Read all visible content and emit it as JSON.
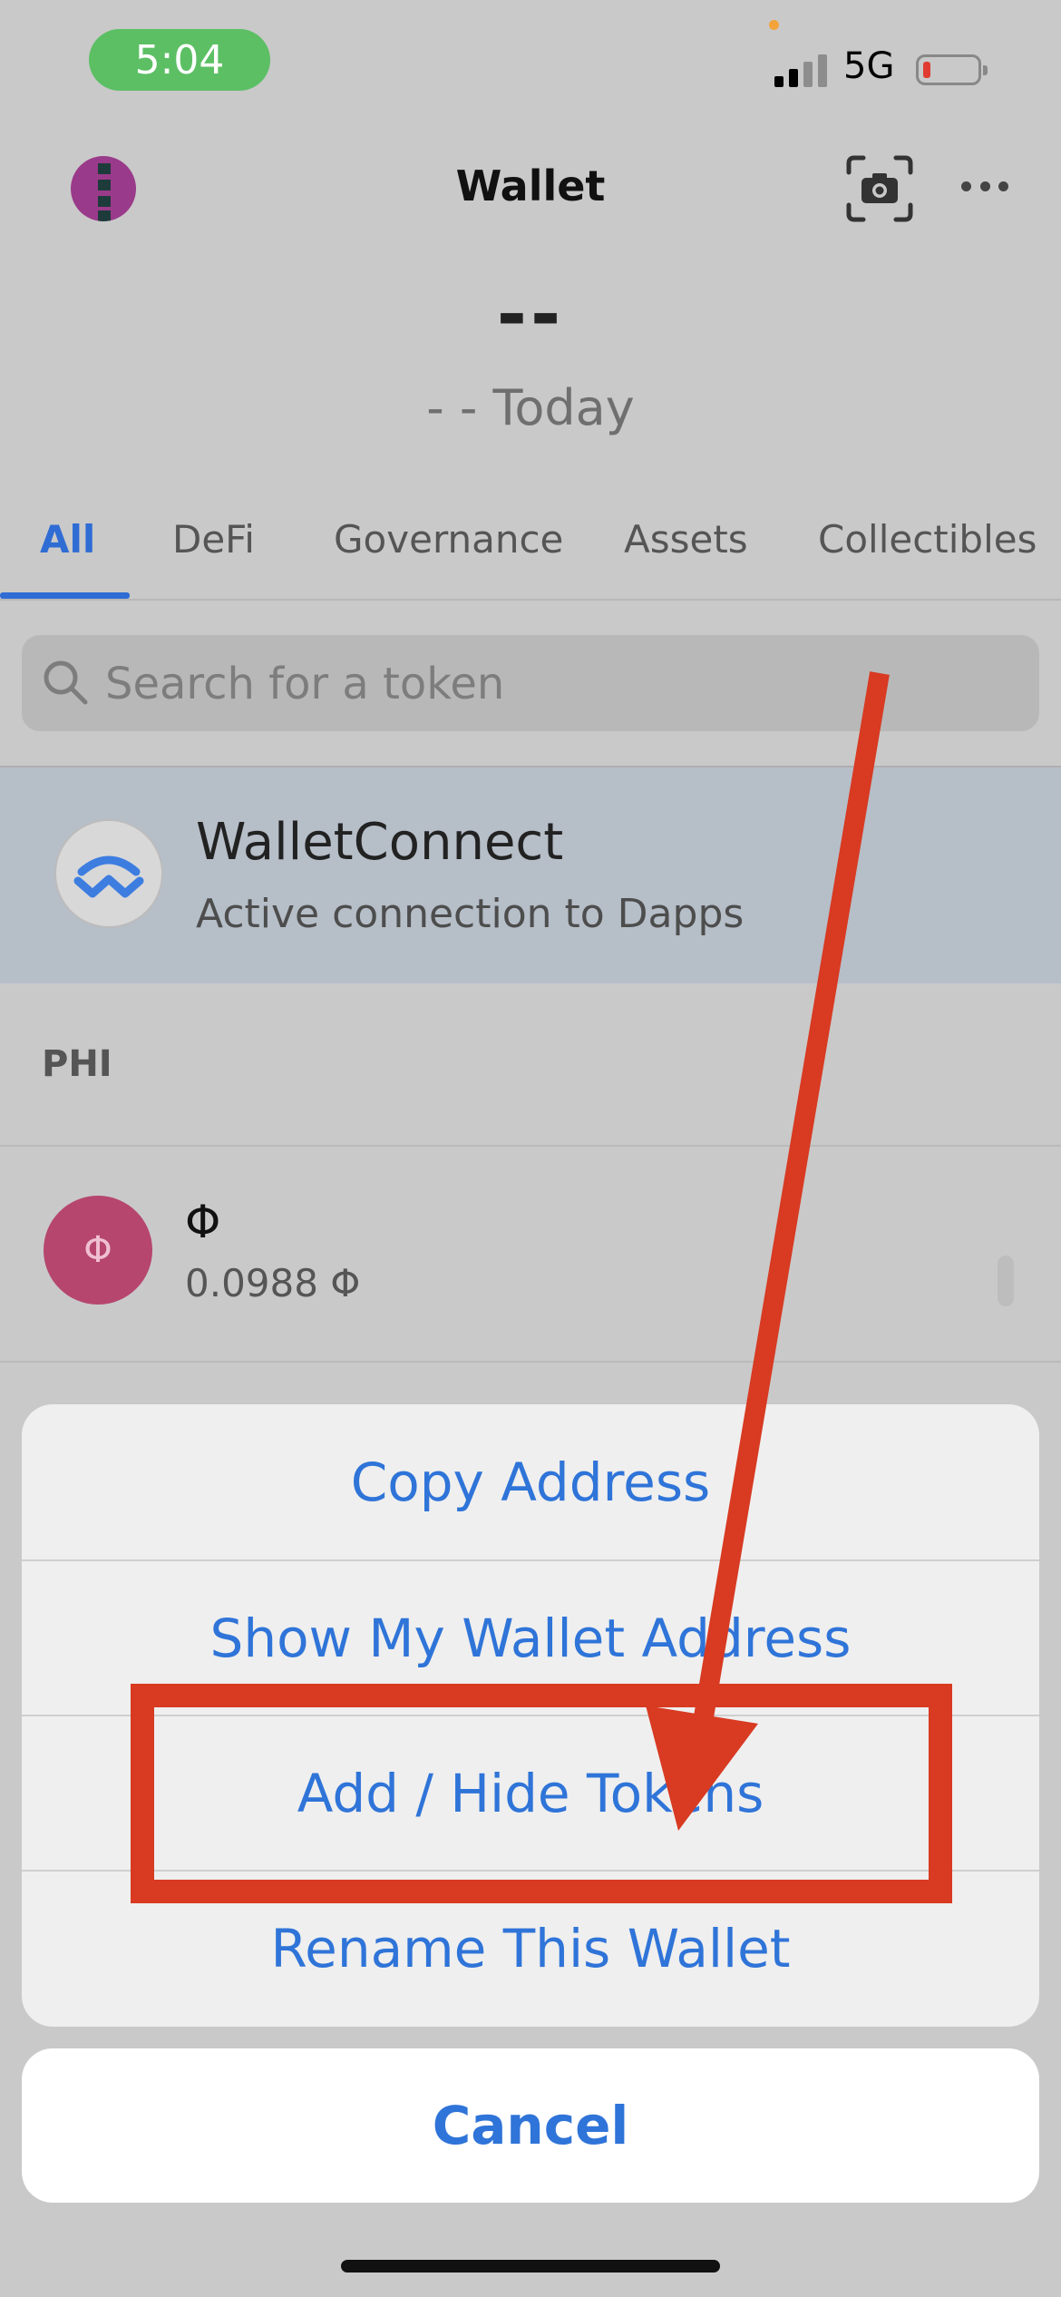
{
  "status_bar": {
    "time": "5:04",
    "network": "5G"
  },
  "header": {
    "title": "Wallet"
  },
  "balance": {
    "value": "--",
    "change": "- - Today"
  },
  "tabs": [
    {
      "label": "All",
      "active": true
    },
    {
      "label": "DeFi"
    },
    {
      "label": "Governance"
    },
    {
      "label": "Assets"
    },
    {
      "label": "Collectibles"
    }
  ],
  "search": {
    "placeholder": "Search for a token"
  },
  "walletconnect": {
    "title": "WalletConnect",
    "subtitle": "Active connection to Dapps"
  },
  "section_title": "PHI",
  "token": {
    "symbol": "Φ",
    "icon_glyph": "Φ",
    "balance": "0.0988 Φ"
  },
  "action_sheet": {
    "items": [
      "Copy Address",
      "Show My Wallet Address",
      "Add / Hide Tokens",
      "Rename This Wallet"
    ],
    "cancel": "Cancel"
  },
  "colors": {
    "accent": "#2f6cd4",
    "annotation_red": "#d83a22",
    "status_pill_green": "#5cbf64"
  },
  "icons": [
    "avatar",
    "scan-icon",
    "more-icon",
    "search-icon",
    "walletconnect-logo-icon",
    "token-phi-icon"
  ]
}
